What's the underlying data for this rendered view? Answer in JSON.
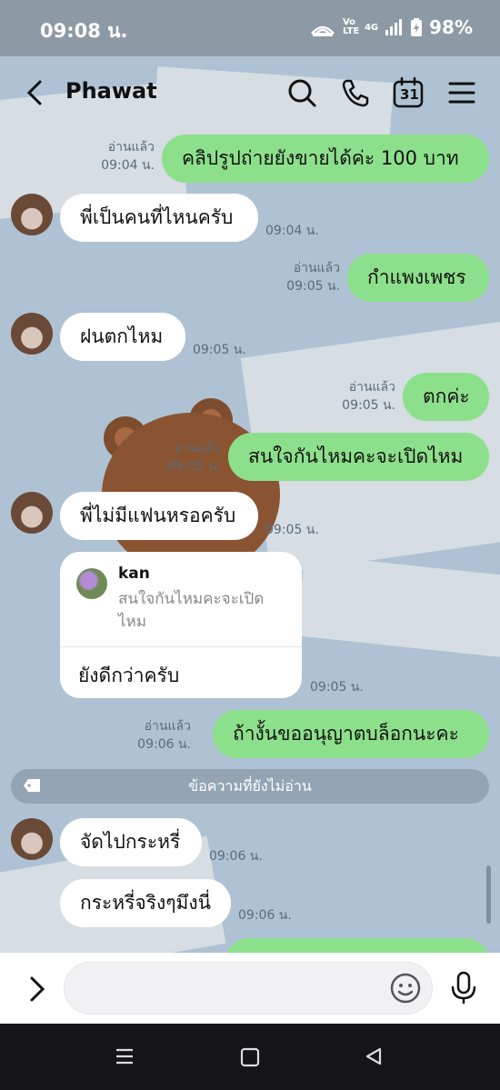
{
  "status_bar": {
    "time": "09:08 น.",
    "network_label": "4G",
    "volte_label": "Vo LTE",
    "battery": "98%",
    "icons": [
      "hotspot-icon",
      "volte-icon",
      "signal-icon",
      "battery-icon"
    ]
  },
  "header": {
    "title": "Phawat",
    "calendar_day": "31",
    "icons": [
      "back-icon",
      "search-icon",
      "phone-icon",
      "calendar-icon",
      "menu-icon"
    ]
  },
  "messages": [
    {
      "side": "out",
      "text": "คลิปรูปถ่ายยังขายได้ค่ะ 100 บาท",
      "read": "อ่านแล้ว",
      "time": "09:04 น."
    },
    {
      "side": "in",
      "text": "พี่เป็นคนที่ไหนครับ",
      "time": "09:04 น."
    },
    {
      "side": "out",
      "text": "กำแพงเพชร",
      "read": "อ่านแล้ว",
      "time": "09:05 น."
    },
    {
      "side": "in",
      "text": "ฝนตกไหม",
      "time": "09:05 น."
    },
    {
      "side": "out",
      "text": "ตกค่ะ",
      "read": "อ่านแล้ว",
      "time": "09:05 น."
    },
    {
      "side": "out",
      "text": "สนใจกันไหมคะจะเปิดไหม",
      "read": "อ่านแล้ว",
      "time": "09:05 น."
    },
    {
      "side": "in",
      "text": "พี่ไม่มีแฟนหรอครับ",
      "time": "09:05 น."
    },
    {
      "side": "in",
      "type": "reply",
      "quote_name": "kan",
      "quote_text": "สนใจกันไหมคะจะเปิดไหม",
      "text": "ยังดีกว่าครับ",
      "time": "09:05 น."
    },
    {
      "side": "out",
      "text": "ถ้างั้นขออนุญาตบล็อกนะคะ",
      "read": "อ่านแล้ว",
      "time": "09:06 น."
    },
    {
      "side": "in",
      "text": "จัดไปกระหรี่",
      "time": "09:06 น."
    },
    {
      "side": "in",
      "text": "กระหรี่จริงๆมึงนี่",
      "time": "09:06 น."
    }
  ],
  "unread_divider": "ข้อความที่ยังไม่อ่าน",
  "input": {
    "placeholder": ""
  },
  "colors": {
    "out_bubble": "#8de08b",
    "in_bubble": "#ffffff",
    "chat_bg": "#aec2d4"
  }
}
